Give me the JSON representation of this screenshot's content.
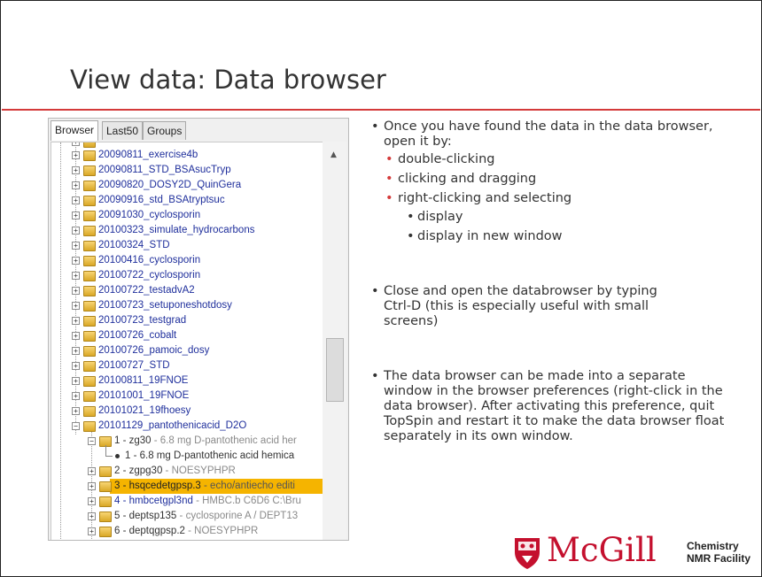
{
  "slide": {
    "title": "View data: Data browser"
  },
  "browser": {
    "tabs": [
      {
        "label": "Browser",
        "active": true
      },
      {
        "label": "Last50",
        "active": false
      },
      {
        "label": "Groups",
        "active": false
      }
    ],
    "items": [
      {
        "label": "20090811_exercise4b"
      },
      {
        "label": "20090811_STD_BSAsucTryp"
      },
      {
        "label": "20090820_DOSY2D_QuinGera"
      },
      {
        "label": "20090916_std_BSAtryptsuc"
      },
      {
        "label": "20091030_cyclosporin"
      },
      {
        "label": "20100323_simulate_hydrocarbons"
      },
      {
        "label": "20100324_STD"
      },
      {
        "label": "20100416_cyclosporin"
      },
      {
        "label": "20100722_cyclosporin"
      },
      {
        "label": "20100722_testadvA2"
      },
      {
        "label": "20100723_setuponeshotdosy"
      },
      {
        "label": "20100723_testgrad"
      },
      {
        "label": "20100726_cobalt"
      },
      {
        "label": "20100726_pamoic_dosy"
      },
      {
        "label": "20100727_STD"
      },
      {
        "label": "20100811_19FNOE"
      },
      {
        "label": "20101001_19FNOE"
      },
      {
        "label": "20101021_19fhoesy"
      },
      {
        "label": "20101129_pantothenicacid_D2O"
      }
    ],
    "experiments": [
      {
        "label": "1 - zg30",
        "desc": " - 6.8 mg D-pantothenic acid her"
      },
      {
        "label": "1 - 6.8 mg D-pantothenic acid hemica",
        "desc": ""
      },
      {
        "label": "2 - zgpg30",
        "desc": " - NOESYPHPR"
      },
      {
        "label": "3 - hsqcedetgpsp.3",
        "desc": " - echo/antiecho editi"
      },
      {
        "label": "4 - hmbcetgpl3nd",
        "desc": " - HMBC.b C6D6 C:\\Bru"
      },
      {
        "label": "5 - deptsp135",
        "desc": " - cyclosporine A / DEPT13"
      },
      {
        "label": "6 - deptqgpsp.2",
        "desc": " - NOESYPHPR"
      }
    ],
    "selected_experiment": "3 - hsqcedetgpsp.3"
  },
  "bullets": {
    "b1": "Once you have found the data in the data browser, open it by:",
    "b1_sub": [
      "double-clicking",
      "clicking and dragging",
      "right-clicking and selecting"
    ],
    "b1_sub3": [
      "display",
      "display in new window"
    ],
    "b2": "Close and open the databrowser by typing Ctrl-D (this is especially useful with small screens)",
    "b3": "The data browser can be made into a separate window in the browser preferences (right-click in the data browser).  After activating this preference, quit TopSpin and restart it to make the data browser float separately in its own window."
  },
  "logo": {
    "brand": "McGill",
    "line1": "Chemistry",
    "line2": "NMR Facility"
  },
  "colors": {
    "accent_red": "#d43a3a",
    "brand_red": "#c4102e",
    "link_blue": "#1f2f9c",
    "selection": "#f5b400"
  }
}
